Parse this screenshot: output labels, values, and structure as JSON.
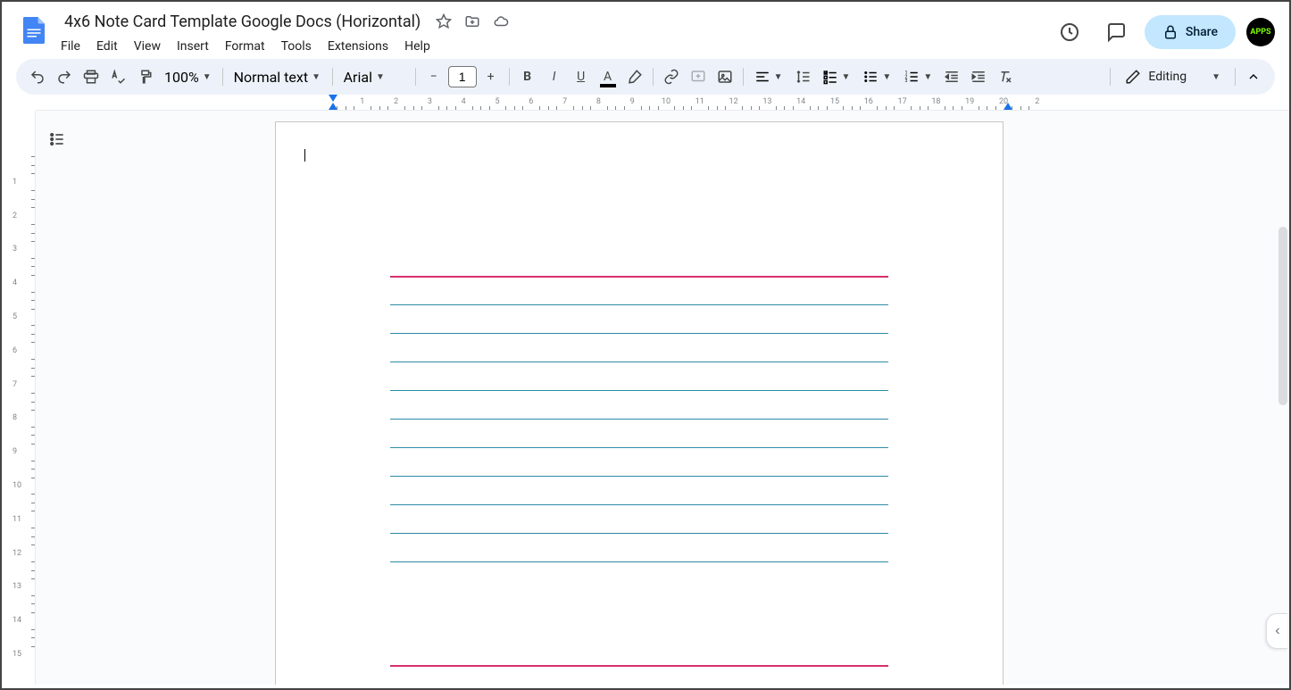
{
  "doc": {
    "title": "4x6 Note Card Template Google Docs (Horizontal)"
  },
  "menu": {
    "file": "File",
    "edit": "Edit",
    "view": "View",
    "insert": "Insert",
    "format": "Format",
    "tools": "Tools",
    "extensions": "Extensions",
    "help": "Help"
  },
  "toolbar": {
    "zoom": "100%",
    "style": "Normal text",
    "font": "Arial",
    "font_size": "1",
    "editing": "Editing"
  },
  "header": {
    "share": "Share",
    "avatar": "APPS"
  },
  "ruler_h": [
    "1",
    "2",
    "3",
    "4",
    "5",
    "6",
    "7",
    "8",
    "9",
    "10",
    "11",
    "12",
    "13",
    "14",
    "15",
    "16",
    "17",
    "18",
    "19",
    "20",
    "2"
  ],
  "ruler_v": [
    "1",
    "2",
    "3",
    "4",
    "5",
    "6",
    "7",
    "8",
    "9",
    "10",
    "11",
    "12",
    "13",
    "14",
    "15"
  ],
  "colors": {
    "red": "#d82f6e",
    "blue": "#2d8ba6",
    "toolbar_bg": "#edf2fa",
    "share_bg": "#c2e7ff"
  }
}
